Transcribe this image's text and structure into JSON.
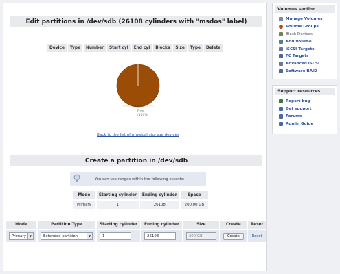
{
  "edit": {
    "title": "Edit partitions in /dev/sdb (26108 cylinders with \"msdos\" label)",
    "columns": [
      "Device",
      "Type",
      "Number",
      "Start cyl",
      "End cyl",
      "Blocks",
      "Size",
      "Type",
      "Delete"
    ],
    "chart": {
      "free_label": "Free",
      "free_percent": "(100%)",
      "free_fraction": 1.0,
      "color": "#9b4c07"
    },
    "back_link": "Back to the list of physical storage devices"
  },
  "create": {
    "title": "Create a partition in /dev/sdb",
    "tip": "You can use ranges within the following extents:",
    "extent_columns": [
      "Mode",
      "Starting cylinder",
      "Ending cylinder",
      "Space"
    ],
    "extent_row": [
      "Primary",
      "1",
      "26108",
      "200.00 GB"
    ],
    "form_columns": [
      "Mode",
      "Partition Type",
      "Starting cylinder",
      "Ending cylinder",
      "Size",
      "Create",
      "Reset"
    ],
    "form": {
      "mode": "Primary",
      "partition_type": "Extended partition",
      "start_cyl": "1",
      "end_cyl": "26108",
      "size": "200 GB",
      "create_button": "Create",
      "reset_link": "Reset"
    }
  },
  "sidebar": {
    "volumes_title": "Volumes section",
    "volumes": [
      {
        "label": "Manage Volumes",
        "icon": "drive-icon",
        "color": "#7a8a9a"
      },
      {
        "label": "Volume Groups",
        "icon": "group-icon",
        "color": "#c04020"
      },
      {
        "label": "Block Devices",
        "icon": "block-icon",
        "color": "#6a8a4a"
      },
      {
        "label": "Add Volume",
        "icon": "add-icon",
        "color": "#5a7a9a"
      },
      {
        "label": "iSCSI Targets",
        "icon": "target-icon",
        "color": "#6a7a8a"
      },
      {
        "label": "FC Targets",
        "icon": "fc-icon",
        "color": "#4a6a9a"
      },
      {
        "label": "Advanced iSCSI",
        "icon": "advanced-icon",
        "color": "#6a7a8a"
      },
      {
        "label": "Software RAID",
        "icon": "raid-icon",
        "color": "#4a6a9a"
      }
    ],
    "support_title": "Support resources",
    "support": [
      {
        "label": "Report bug",
        "icon": "bug-icon",
        "color": "#3a7a3a"
      },
      {
        "label": "Get support",
        "icon": "support-icon",
        "color": "#4a6a9a"
      },
      {
        "label": "Forums",
        "icon": "forum-icon",
        "color": "#4a6a9a"
      },
      {
        "label": "Admin Guide",
        "icon": "guide-icon",
        "color": "#4a6a9a"
      }
    ]
  }
}
